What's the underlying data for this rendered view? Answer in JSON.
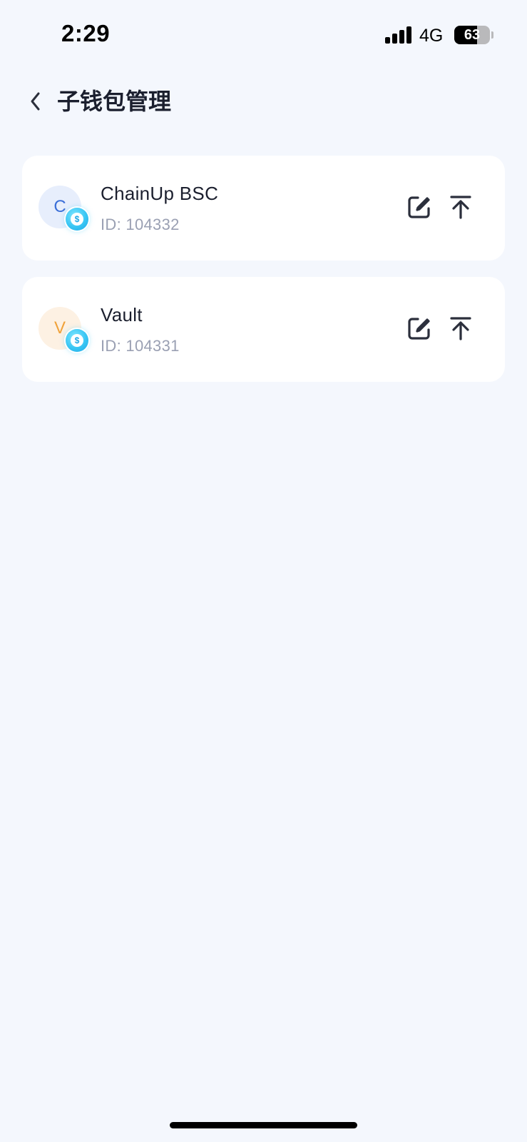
{
  "status_bar": {
    "time": "2:29",
    "network": "4G",
    "battery_percent": "63",
    "battery_level": 0.63
  },
  "nav": {
    "back_icon": "chevron-left-icon",
    "title": "子钱包管理"
  },
  "wallets": [
    {
      "initial": "C",
      "name": "ChainUp BSC",
      "id_text": "ID: 104332",
      "avatar_bg": "#e7eefc",
      "avatar_color": "#3b6fd8",
      "badge_icon": "coin-shield-icon",
      "badge_symbol": "$",
      "edit_icon": "edit-icon",
      "pin_top_icon": "pin-to-top-icon"
    },
    {
      "initial": "V",
      "name": "Vault",
      "id_text": "ID: 104331",
      "avatar_bg": "#fdf1e3",
      "avatar_color": "#f0a23a",
      "badge_icon": "coin-shield-icon",
      "badge_symbol": "$",
      "edit_icon": "edit-icon",
      "pin_top_icon": "pin-to-top-icon"
    }
  ],
  "colors": {
    "background": "#f4f7fd",
    "card": "#ffffff",
    "text_primary": "#1b1f2e",
    "text_secondary": "#9aa0b3",
    "icon": "#2b2f3c"
  }
}
